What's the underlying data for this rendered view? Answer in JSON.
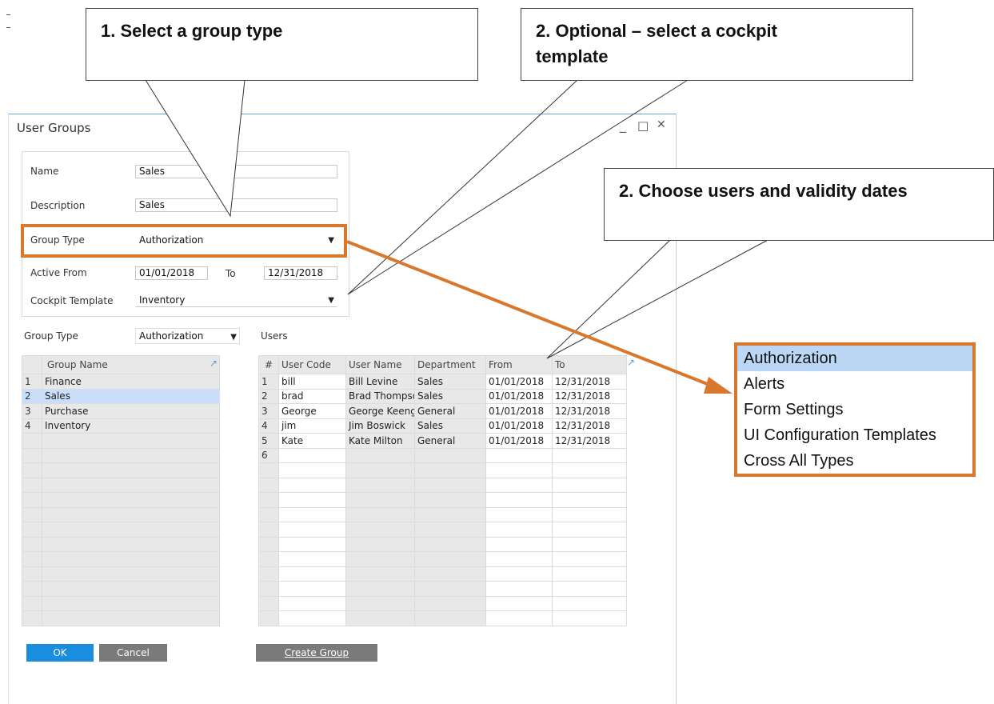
{
  "callouts": {
    "c1": "1. Select a group type",
    "c2a": "2. Optional – select a cockpit",
    "c2b": "template",
    "c3": "2. Choose users and validity dates"
  },
  "window": {
    "title": "User Groups",
    "controls": {
      "minimize": "_",
      "maximize": "□",
      "close": "✕"
    }
  },
  "form": {
    "name_label": "Name",
    "name_value": "Sales",
    "desc_label": "Description",
    "desc_value": "Sales",
    "group_type_label": "Group Type",
    "group_type_value": "Authorization",
    "active_from_label": "Active From",
    "active_from_value": "01/01/2018",
    "to_label": "To",
    "to_value": "12/31/2018",
    "cockpit_label": "Cockpit Template",
    "cockpit_value": "Inventory"
  },
  "filter": {
    "label": "Group Type",
    "value": "Authorization"
  },
  "groups": {
    "header": "Group Name",
    "rows": [
      {
        "n": "1",
        "name": "Finance"
      },
      {
        "n": "2",
        "name": "Sales"
      },
      {
        "n": "3",
        "name": "Purchase"
      },
      {
        "n": "4",
        "name": "Inventory"
      }
    ],
    "selected": 1
  },
  "users": {
    "label": "Users",
    "headers": [
      "#",
      "User Code",
      "User Name",
      "Department",
      "From",
      "To"
    ],
    "rows": [
      [
        "1",
        "bill",
        "Bill Levine",
        "Sales",
        "01/01/2018",
        "12/31/2018"
      ],
      [
        "2",
        "brad",
        "Brad Thompson",
        "Sales",
        "01/01/2018",
        "12/31/2018"
      ],
      [
        "3",
        "George",
        "George Keeng",
        "General",
        "01/01/2018",
        "12/31/2018"
      ],
      [
        "4",
        "jim",
        "Jim Boswick",
        "Sales",
        "01/01/2018",
        "12/31/2018"
      ],
      [
        "5",
        "Kate",
        "Kate Milton",
        "General",
        "01/01/2018",
        "12/31/2018"
      ],
      [
        "6",
        "",
        "",
        "",
        "",
        ""
      ]
    ]
  },
  "buttons": {
    "ok": "OK",
    "cancel": "Cancel",
    "create": "Create Group"
  },
  "dropdown": {
    "options": [
      "Authorization",
      "Alerts",
      "Form Settings",
      "UI Configuration Templates",
      "Cross All Types"
    ],
    "selected": 0
  },
  "colors": {
    "accent_orange": "#d9782d",
    "ok_blue": "#1a8de0",
    "button_gray": "#7a7a7a",
    "selection_blue": "#c9defa"
  }
}
